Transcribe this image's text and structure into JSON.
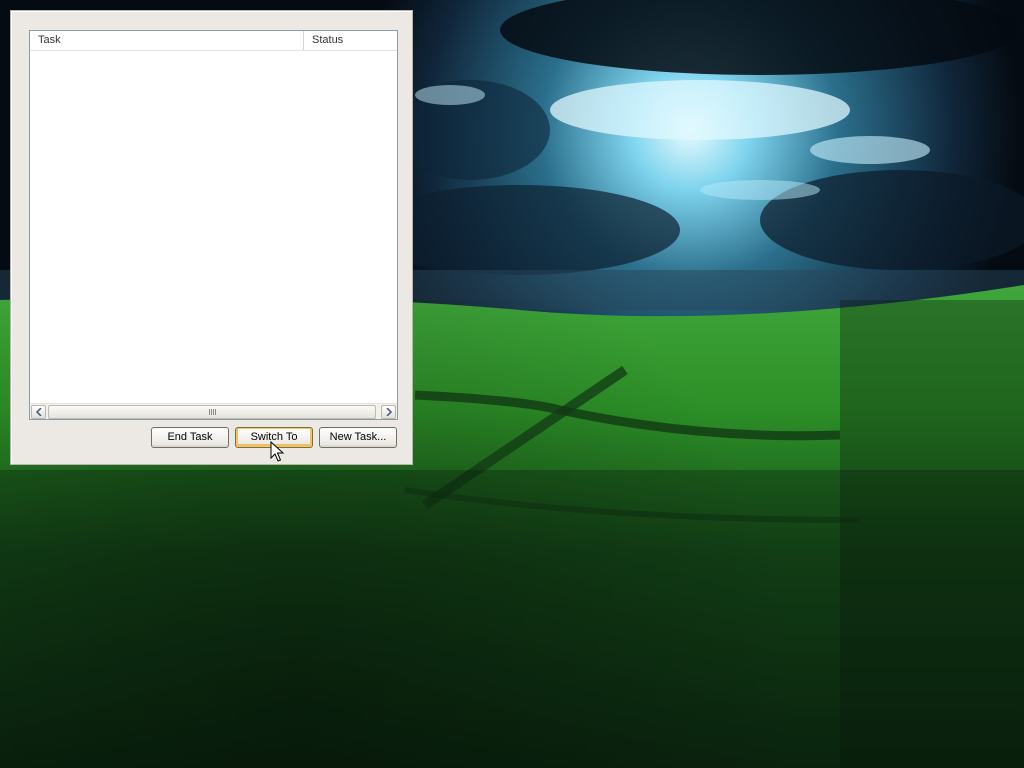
{
  "task_manager": {
    "columns": {
      "task": "Task",
      "status": "Status"
    },
    "rows": [],
    "buttons": {
      "end_task": "End Task",
      "switch_to": "Switch To",
      "new_task": "New Task..."
    }
  },
  "icons": {
    "scroll_left": "arrow-left-icon",
    "scroll_right": "arrow-right-icon",
    "cursor": "mouse-pointer-icon"
  },
  "colors": {
    "window_bg": "#ece9e4",
    "focus_button_accent": "#f5c76b"
  }
}
